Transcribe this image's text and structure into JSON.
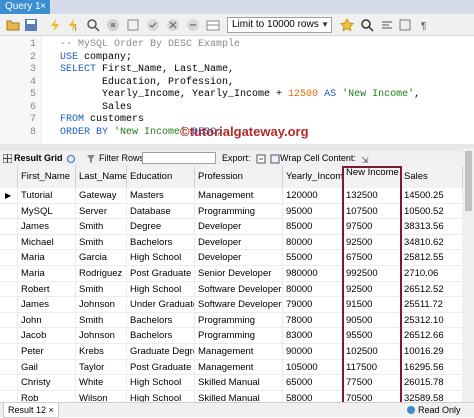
{
  "tabbar": {
    "title": "Query 1",
    "close": "×"
  },
  "toolbar": {
    "limit_label": "Limit to 10000 rows"
  },
  "editor": {
    "line_numbers": [
      "1",
      "2",
      "3",
      "4",
      "5",
      "6",
      "7",
      "8"
    ],
    "lines": [
      [
        {
          "t": "-- MySQL Order By DESC Example",
          "c": "cm"
        }
      ],
      [
        {
          "t": "USE ",
          "c": "kw"
        },
        {
          "t": "company;",
          "c": ""
        }
      ],
      [
        {
          "t": "SELECT ",
          "c": "kw"
        },
        {
          "t": "First_Name, Last_Name,",
          "c": ""
        }
      ],
      [
        {
          "t": "       Education, Profession,",
          "c": ""
        }
      ],
      [
        {
          "t": "       Yearly_Income, Yearly_Income + ",
          "c": ""
        },
        {
          "t": "12500",
          "c": "num"
        },
        {
          "t": " AS ",
          "c": "kw"
        },
        {
          "t": "'New Income'",
          "c": "str"
        },
        {
          "t": ",",
          "c": ""
        }
      ],
      [
        {
          "t": "       Sales",
          "c": ""
        }
      ],
      [
        {
          "t": "FROM ",
          "c": "kw"
        },
        {
          "t": "customers",
          "c": ""
        }
      ],
      [
        {
          "t": "ORDER BY ",
          "c": "kw"
        },
        {
          "t": "'New Income'",
          "c": "str"
        },
        {
          "t": " DESC;",
          "c": "kw"
        }
      ]
    ],
    "watermark": "©tutorialgateway.org"
  },
  "result_bar": {
    "grid_label": "Result Grid",
    "filter_label": "Filter Rows:",
    "export_label": "Export:",
    "wrap_label": "Wrap Cell Content:"
  },
  "grid": {
    "columns": [
      "First_Name",
      "Last_Name",
      "Education",
      "Profession",
      "Yearly_Income",
      "New Income",
      "Sales"
    ],
    "rows": [
      [
        "Tutorial",
        "Gateway",
        "Masters",
        "Management",
        "120000",
        "132500",
        "14500.25"
      ],
      [
        "MySQL",
        "Server",
        "Database",
        "Programming",
        "95000",
        "107500",
        "10500.52"
      ],
      [
        "James",
        "Smith",
        "Degree",
        "Developer",
        "85000",
        "97500",
        "38313.56"
      ],
      [
        "Michael",
        "Smith",
        "Bachelors",
        "Developer",
        "80000",
        "92500",
        "34810.62"
      ],
      [
        "Maria",
        "Garcia",
        "High School",
        "Developer",
        "55000",
        "67500",
        "25812.55"
      ],
      [
        "Maria",
        "Rodriguez",
        "Post Graduate",
        "Senior Developer",
        "980000",
        "992500",
        "2710.06"
      ],
      [
        "Robert",
        "Smith",
        "High School",
        "Software Developer",
        "80000",
        "92500",
        "26512.52"
      ],
      [
        "James",
        "Johnson",
        "Under Graduate",
        "Software Developer",
        "79000",
        "91500",
        "25511.72"
      ],
      [
        "John",
        "Smith",
        "Bachelors",
        "Programming",
        "78000",
        "90500",
        "25312.10"
      ],
      [
        "Jacob",
        "Johnson",
        "Bachelors",
        "Programming",
        "83000",
        "95500",
        "26512.66"
      ],
      [
        "Peter",
        "Krebs",
        "Graduate Degree",
        "Management",
        "90000",
        "102500",
        "10016.29"
      ],
      [
        "Gail",
        "Taylor",
        "Post Graduate",
        "Management",
        "105000",
        "117500",
        "16295.56"
      ],
      [
        "Christy",
        "White",
        "High School",
        "Skilled Manual",
        "65000",
        "77500",
        "26015.78"
      ],
      [
        "Rob",
        "Wilson",
        "High School",
        "Skilled Manual",
        "58000",
        "70500",
        "32589.58"
      ]
    ]
  },
  "status": {
    "result_tab": "Result 12 ×",
    "ready": "Read Only"
  }
}
